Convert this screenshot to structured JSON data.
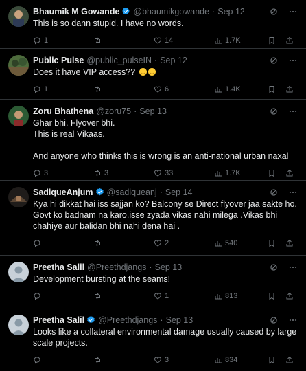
{
  "tweets": [
    {
      "name": "Bhaumik M Gowande",
      "verified": true,
      "handle": "@bhaumikgowande",
      "date": "Sep 12",
      "text": [
        "This is so dann stupid. I have no words."
      ],
      "replies": "1",
      "retweets": "",
      "likes": "14",
      "views": "1.7K"
    },
    {
      "name": "Public Pulse",
      "verified": false,
      "handle": "@public_pulseIN",
      "date": "Sep 12",
      "text": [
        "Does it have VIP access??"
      ],
      "replies": "1",
      "retweets": "",
      "likes": "6",
      "views": "1.4K"
    },
    {
      "name": "Zoru Bhathena",
      "verified": false,
      "handle": "@zoru75",
      "date": "Sep 13",
      "text": [
        "Ghar bhi. Flyover bhi.",
        "This is real Vikaas.",
        "",
        "And anyone who thinks this is wrong is an anti-national urban naxal"
      ],
      "replies": "3",
      "retweets": "3",
      "likes": "33",
      "views": "1.7K"
    },
    {
      "name": "SadiqueAnjum",
      "verified": true,
      "handle": "@sadiqueanj",
      "date": "Sep 14",
      "text": [
        "Kya hi dikkat hai iss sajjan ko? Balcony se Direct flyover jaa sakte ho. Govt ko badnam na karo.isse zyada vikas nahi milega .Vikas bhi chahiye aur balidan bhi nahi dena hai ."
      ],
      "replies": "",
      "retweets": "",
      "likes": "2",
      "views": "540"
    },
    {
      "name": "Preetha Salil",
      "verified": false,
      "handle": "@Preethdjangs",
      "date": "Sep 13",
      "text": [
        "Development bursting at the seams!"
      ],
      "replies": "",
      "retweets": "",
      "likes": "1",
      "views": "813"
    },
    {
      "name": "Preetha Salil",
      "verified": true,
      "handle": "@Preethdjangs",
      "date": "Sep 13",
      "text": [
        "Looks like a collateral environmental damage usually caused by large scale projects."
      ],
      "replies": "",
      "retweets": "",
      "likes": "3",
      "views": "834"
    }
  ],
  "colors": {
    "background": "#000000",
    "text": "#e7e9ea",
    "muted": "#71767b",
    "border": "#2f3336",
    "verified": "#1d9bf0"
  },
  "icons": [
    "verified-badge-icon",
    "grok-icon",
    "more-icon",
    "reply-icon",
    "retweet-icon",
    "like-icon",
    "views-icon",
    "bookmark-icon",
    "share-icon"
  ]
}
